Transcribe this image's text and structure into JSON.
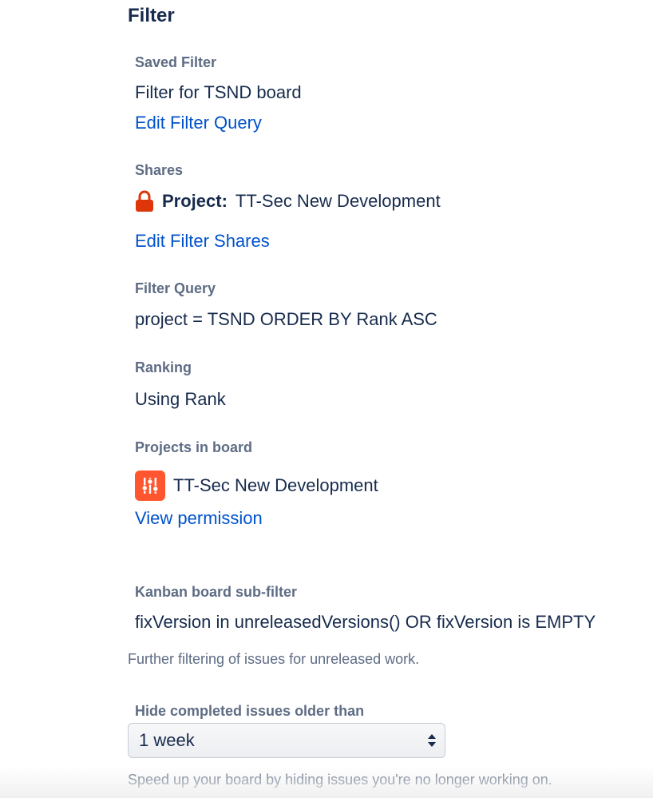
{
  "section": {
    "title": "Filter"
  },
  "saved_filter": {
    "label": "Saved Filter",
    "value": "Filter for TSND board",
    "edit_link": "Edit Filter Query"
  },
  "shares": {
    "label": "Shares",
    "type": "Project:",
    "name": "TT-Sec New Development",
    "icon": "lock-icon",
    "edit_link": "Edit Filter Shares"
  },
  "filter_query": {
    "label": "Filter Query",
    "value": "project = TSND ORDER BY Rank ASC"
  },
  "ranking": {
    "label": "Ranking",
    "value": "Using Rank"
  },
  "projects": {
    "label": "Projects in board",
    "items": [
      {
        "name": "TT-Sec New Development",
        "avatar_color": "#ff5630",
        "icon": "project-avatar-icon"
      }
    ],
    "permission_link": "View permission"
  },
  "subfilter": {
    "label": "Kanban board sub-filter",
    "value": "fixVersion in unreleasedVersions() OR fixVersion is EMPTY",
    "help": "Further filtering of issues for unreleased work."
  },
  "hide_completed": {
    "label": "Hide completed issues older than",
    "selected": "1 week",
    "help": "Speed up your board by hiding issues you're no longer working on."
  },
  "colors": {
    "text": "#172b4d",
    "label": "#5e6c84",
    "link": "#0052cc",
    "lock": "#de350b",
    "avatar": "#ff5630"
  }
}
